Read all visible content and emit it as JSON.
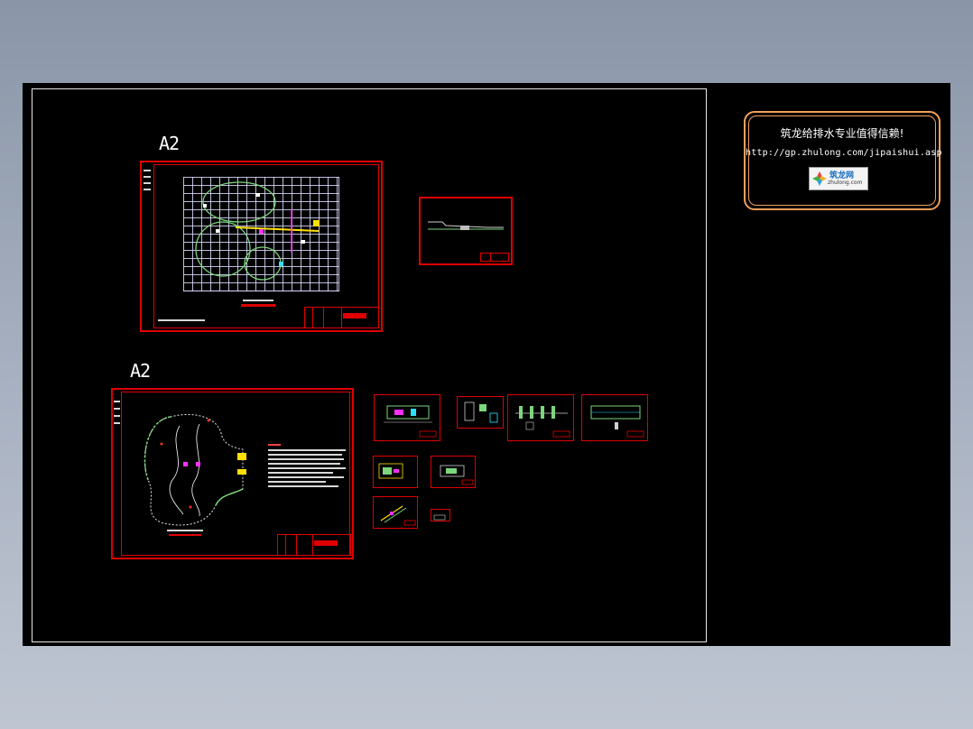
{
  "sheet_labels": {
    "top_left": "A2",
    "bottom_left": "A2"
  },
  "watermark": {
    "title": "筑龙给排水专业值得信赖!",
    "url": "http://gp.zhulong.com/jipaishui.asp",
    "logo_text": "筑龙网",
    "logo_site": "zhulong.com"
  },
  "colors": {
    "background": "#000000",
    "frame_red": "#e00000",
    "grid": "#dcdcff",
    "path_green": "#7cd67c",
    "accent_yellow": "#ffe000",
    "accent_magenta": "#ff30ff",
    "accent_cyan": "#30e0ff",
    "watermark_border": "#f1a05a"
  }
}
